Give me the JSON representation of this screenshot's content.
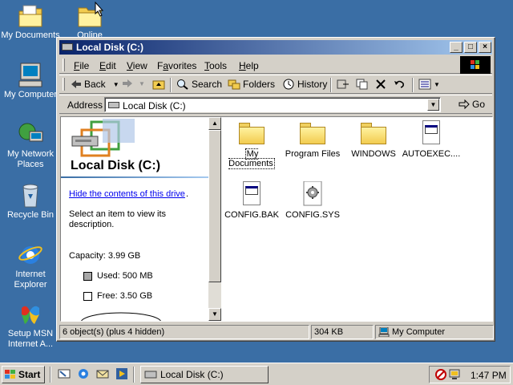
{
  "desktop": {
    "icons": [
      {
        "label": "My Documents",
        "icon": "my-documents-icon"
      },
      {
        "label": "Online",
        "icon": "folder-icon"
      },
      {
        "label": "My Computer",
        "icon": "computer-icon"
      },
      {
        "label": "My Network Places",
        "icon": "network-icon"
      },
      {
        "label": "Recycle Bin",
        "icon": "recycle-bin-icon"
      },
      {
        "label": "Internet Explorer",
        "icon": "ie-icon"
      },
      {
        "label": "Setup MSN Internet A...",
        "icon": "msn-icon"
      }
    ]
  },
  "window": {
    "title": "Local Disk (C:)",
    "menu": [
      {
        "pre": "",
        "key": "F",
        "post": "ile"
      },
      {
        "pre": "",
        "key": "E",
        "post": "dit"
      },
      {
        "pre": "",
        "key": "V",
        "post": "iew"
      },
      {
        "pre": "F",
        "key": "a",
        "post": "vorites"
      },
      {
        "pre": "",
        "key": "T",
        "post": "ools"
      },
      {
        "pre": "",
        "key": "H",
        "post": "elp"
      }
    ],
    "toolbar": {
      "back": "Back",
      "search": "Search",
      "folders": "Folders",
      "history": "History"
    },
    "address": {
      "label": "Address",
      "value": "Local Disk (C:)",
      "go": "Go"
    },
    "left_pane": {
      "title": "Local Disk (C:)",
      "link": "Hide the contents of this drive",
      "description": "Select an item to view its description.",
      "capacity": "Capacity: 3.99 GB",
      "used": "Used: 500 MB",
      "free": "Free: 3.50 GB"
    },
    "files": [
      {
        "name": "My Documents",
        "type": "folder"
      },
      {
        "name": "Program Files",
        "type": "folder"
      },
      {
        "name": "WINDOWS",
        "type": "folder"
      },
      {
        "name": "AUTOEXEC....",
        "type": "doc"
      },
      {
        "name": "CONFIG.BAK",
        "type": "doc"
      },
      {
        "name": "CONFIG.SYS",
        "type": "sys"
      }
    ],
    "status": {
      "objects": "6 object(s) (plus 4 hidden)",
      "size": "304 KB",
      "zone": "My Computer"
    }
  },
  "taskbar": {
    "start": "Start",
    "task": "Local Disk (C:)",
    "clock": "1:47 PM"
  },
  "colors": {
    "desktop": "#3a6ea5",
    "title_active": "#0a246a",
    "face": "#d4d0c8"
  }
}
